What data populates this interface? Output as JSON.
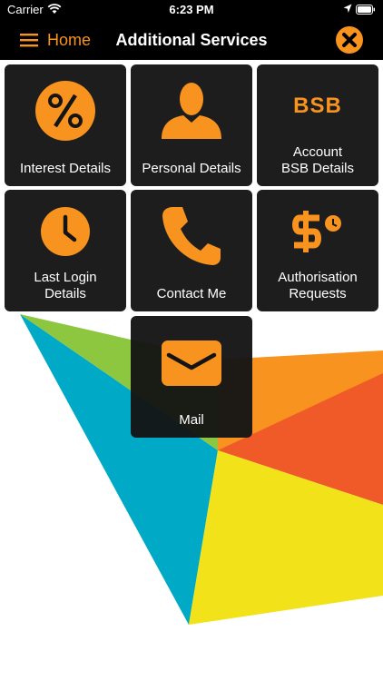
{
  "status_bar": {
    "carrier": "Carrier",
    "time": "6:23 PM"
  },
  "nav": {
    "home_label": "Home",
    "title": "Additional Services"
  },
  "colors": {
    "accent": "#f7931e",
    "tile_bg": "#141414",
    "nav_bg": "#000000"
  },
  "tiles": [
    {
      "label": "Interest Details",
      "icon": "percent-icon"
    },
    {
      "label": "Personal Details",
      "icon": "person-icon"
    },
    {
      "label": "Account\nBSB Details",
      "icon": "bsb-icon",
      "icon_text": "BSB"
    },
    {
      "label": "Last Login\nDetails",
      "icon": "clock-icon"
    },
    {
      "label": "Contact Me",
      "icon": "phone-icon"
    },
    {
      "label": "Authorisation\nRequests",
      "icon": "dollar-clock-icon"
    },
    {
      "label": "Mail",
      "icon": "mail-icon"
    }
  ]
}
